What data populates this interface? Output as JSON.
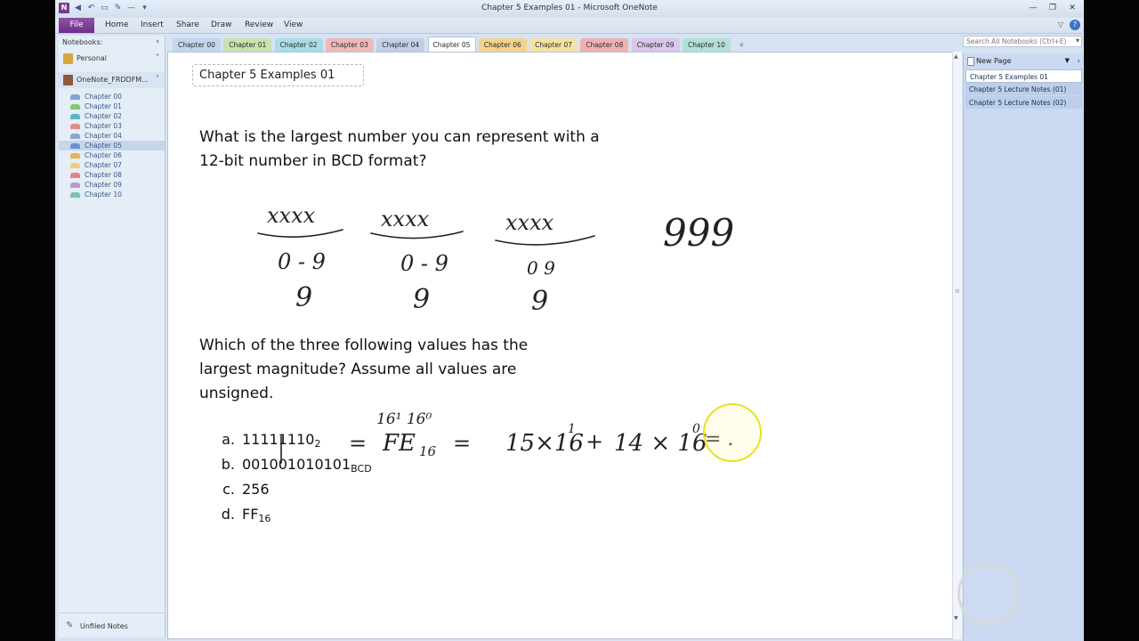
{
  "window": {
    "title": "Chapter 5 Examples 01 - Microsoft OneNote",
    "app_icon": "N"
  },
  "ribbon": {
    "file": "File",
    "tabs": [
      "Home",
      "Insert",
      "Share",
      "Draw",
      "Review",
      "View"
    ]
  },
  "nav": {
    "header": "Notebooks:",
    "notebooks": [
      {
        "label": "Personal",
        "color": "#d9a441"
      },
      {
        "label": "OneNote_FRDDFM...",
        "color": "#8a5a3a"
      }
    ],
    "sections": [
      {
        "label": "Chapter 00",
        "color": "#7fa6d6"
      },
      {
        "label": "Chapter 01",
        "color": "#8cc56e"
      },
      {
        "label": "Chapter 02",
        "color": "#59b8c8"
      },
      {
        "label": "Chapter 03",
        "color": "#e58b8b"
      },
      {
        "label": "Chapter 04",
        "color": "#8ea6cf"
      },
      {
        "label": "Chapter 05",
        "color": "#6e92c9"
      },
      {
        "label": "Chapter 06",
        "color": "#e6b449"
      },
      {
        "label": "Chapter 07",
        "color": "#ecd17a"
      },
      {
        "label": "Chapter 08",
        "color": "#e08585"
      },
      {
        "label": "Chapter 09",
        "color": "#b99bd3"
      },
      {
        "label": "Chapter 10",
        "color": "#7cc2b3"
      }
    ],
    "footer": "Unfiled Notes"
  },
  "section_tabs": [
    {
      "label": "Chapter 00",
      "color": "#c4d5ee"
    },
    {
      "label": "Chapter 01",
      "color": "#c7e3b0"
    },
    {
      "label": "Chapter 02",
      "color": "#a9dde6"
    },
    {
      "label": "Chapter 03",
      "color": "#f0b9b9"
    },
    {
      "label": "Chapter 04",
      "color": "#c2cfe6"
    },
    {
      "label": "Chapter 05",
      "color": "#ffffff"
    },
    {
      "label": "Chapter 06",
      "color": "#f3d38c"
    },
    {
      "label": "Chapter 07",
      "color": "#f5e3a3"
    },
    {
      "label": "Chapter 08",
      "color": "#efb2b2"
    },
    {
      "label": "Chapter 09",
      "color": "#d9c6ea"
    },
    {
      "label": "Chapter 10",
      "color": "#b3e0d6"
    }
  ],
  "search": {
    "placeholder": "Search All Notebooks (Ctrl+E)"
  },
  "page": {
    "title": "Chapter 5 Examples 01",
    "question1_line1": "What is the largest number you can represent with a",
    "question1_line2": "12-bit number in BCD format?",
    "question2_line1": "Which of the three following values has the",
    "question2_line2": "largest magnitude? Assume all values are",
    "question2_line3": "unsigned.",
    "answers": [
      {
        "letter": "a.",
        "value": "11111110",
        "sub": "2"
      },
      {
        "letter": "b.",
        "value": "001001010101",
        "sub": "BCD"
      },
      {
        "letter": "c.",
        "value": "256",
        "sub": ""
      },
      {
        "letter": "d.",
        "value": "FF",
        "sub": "16"
      }
    ],
    "ink": {
      "x1": "xxxx",
      "x2": "xxxx",
      "x3": "xxxx",
      "r1": "0 - 9",
      "r2": "0 - 9",
      "r3": "0 9",
      "n1": "9",
      "n2": "9",
      "n3": "9",
      "result": "999",
      "exp_top": "16¹ 16⁰",
      "eq1": "=",
      "fe": "FE",
      "fe_sub": "16",
      "eq2": "=",
      "expr_a": "15×16",
      "expr_a_exp": "1",
      "plus": "+",
      "expr_b": "14 × 16",
      "expr_b_exp": "0",
      "eq3": "= ."
    }
  },
  "pagelist": {
    "new_page": "New Page",
    "pages": [
      {
        "label": "Chapter 5 Examples 01",
        "active": true
      },
      {
        "label": "Chapter 5 Lecture Notes (01)",
        "active": false
      },
      {
        "label": "Chapter 5 Lecture Notes (02)",
        "active": false
      }
    ]
  }
}
